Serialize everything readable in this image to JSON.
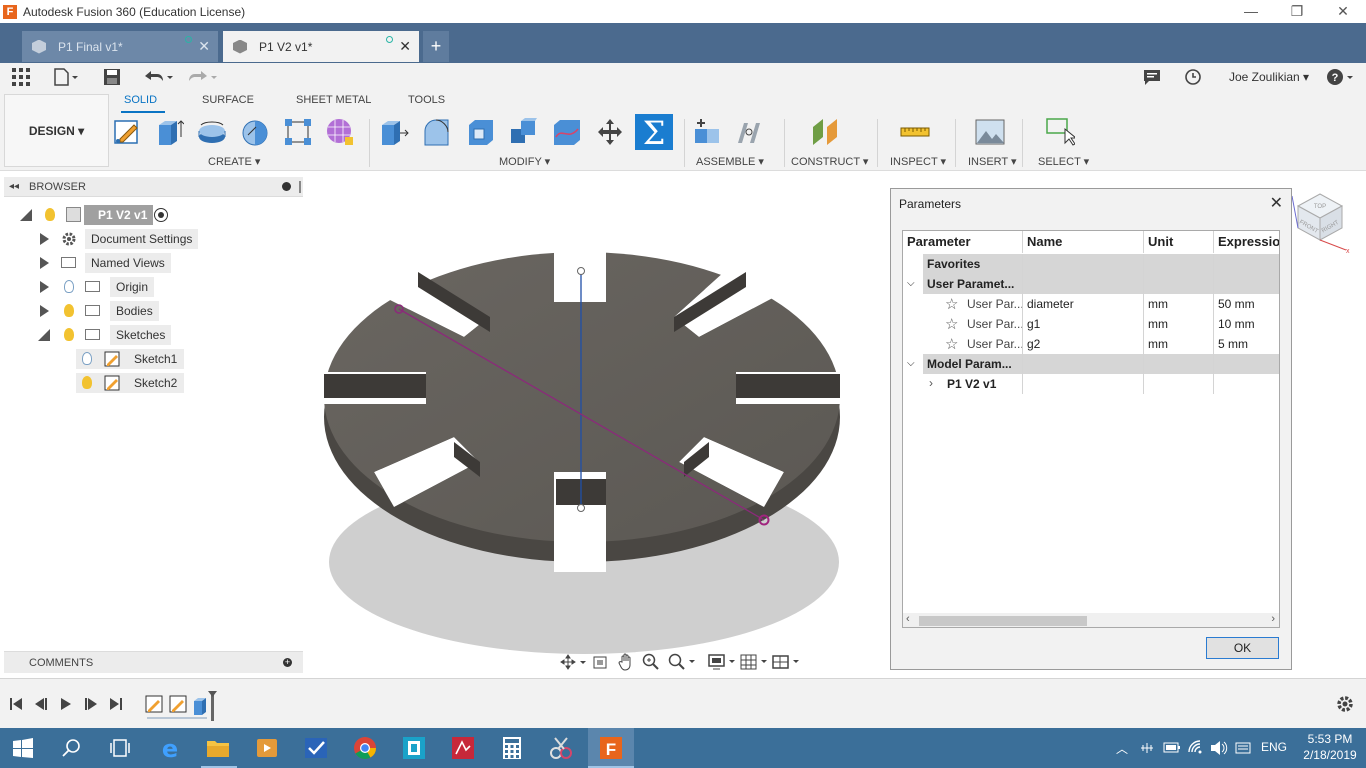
{
  "window": {
    "title": "Autodesk Fusion 360 (Education License)",
    "minimize": "—",
    "restore": "❐",
    "close": "✕"
  },
  "tabs": [
    {
      "label": "P1 Final v1*"
    },
    {
      "label": "P1 V2 v1*"
    }
  ],
  "user": {
    "name": "Joe Zoulikian ▾"
  },
  "workspace": {
    "label": "DESIGN ▾"
  },
  "ribbon_tabs": [
    "SOLID",
    "SURFACE",
    "SHEET METAL",
    "TOOLS"
  ],
  "groups": [
    "CREATE ▾",
    "MODIFY ▾",
    "ASSEMBLE ▾",
    "CONSTRUCT ▾",
    "INSPECT ▾",
    "INSERT ▾",
    "SELECT ▾"
  ],
  "browser": {
    "title": "BROWSER",
    "root": "P1 V2 v1",
    "items": [
      "Document Settings",
      "Named Views",
      "Origin",
      "Bodies",
      "Sketches",
      "Sketch1",
      "Sketch2"
    ]
  },
  "comments": {
    "title": "COMMENTS"
  },
  "dialog": {
    "title": "Parameters",
    "headers": [
      "Parameter",
      "Name",
      "Unit",
      "Expression"
    ],
    "favorites": "Favorites",
    "user_group": "User Paramet...",
    "model_group": "Model Param...",
    "model_item": "P1 V2 v1",
    "rows": [
      {
        "type": "User Par...",
        "name": "diameter",
        "unit": "mm",
        "expr": "50 mm"
      },
      {
        "type": "User Par...",
        "name": "g1",
        "unit": "mm",
        "expr": "10 mm"
      },
      {
        "type": "User Par...",
        "name": "g2",
        "unit": "mm",
        "expr": "5 mm"
      }
    ],
    "ok": "OK"
  },
  "viewcube": {
    "top": "TOP",
    "front": "FRONT",
    "right": "RIGHT"
  },
  "taskbar": {
    "lang": "ENG",
    "time": "5:53 PM",
    "date": "2/18/2019"
  },
  "colors": {
    "tab_bar": "#4b6a8e",
    "accent": "#0a74c4",
    "taskbar": "#3b6f99",
    "body": "#5e5a55"
  }
}
